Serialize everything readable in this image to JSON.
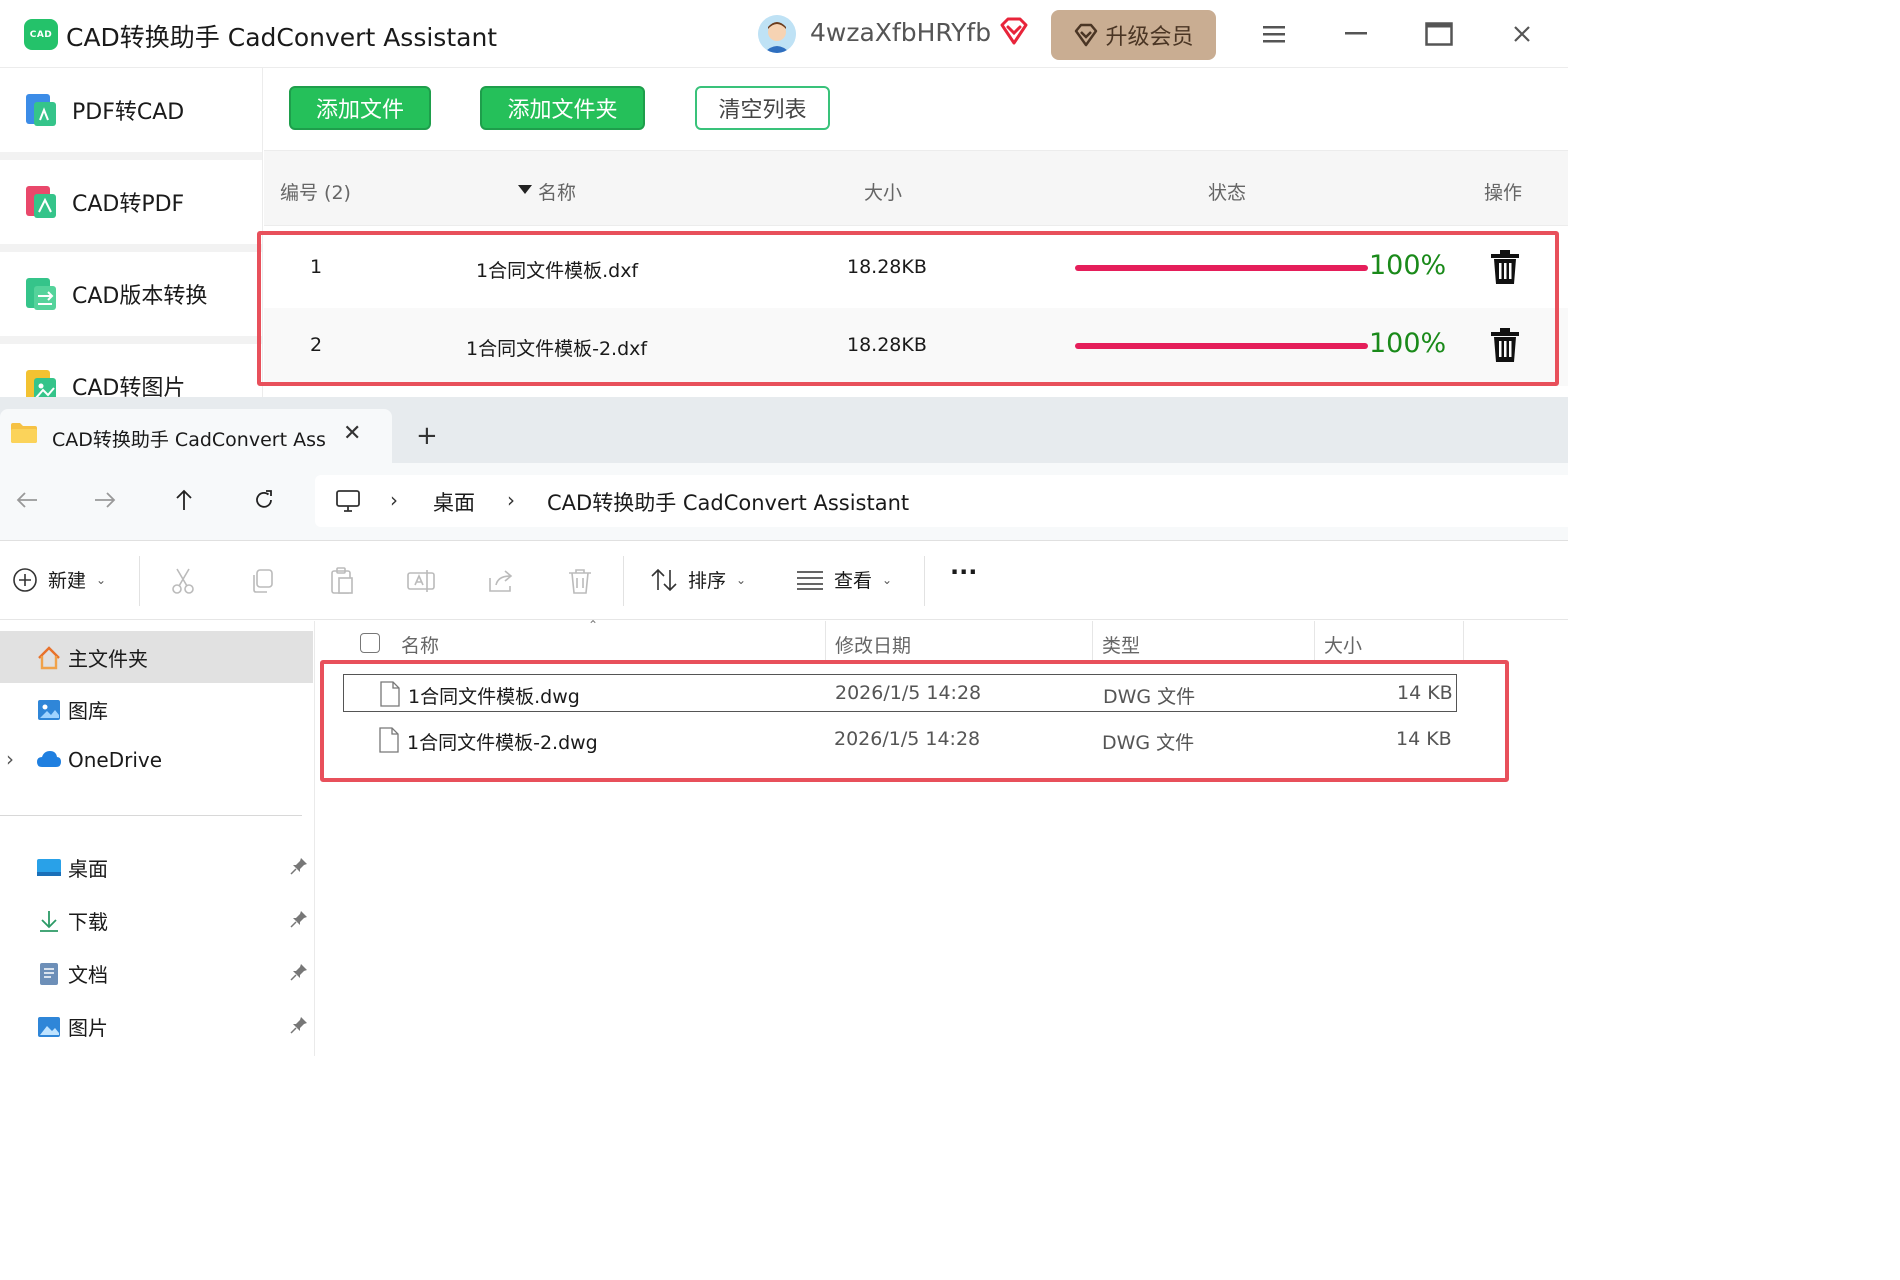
{
  "app": {
    "logo_text": "CAD",
    "title": "CAD转换助手 CadConvert Assistant",
    "username": "4wzaXfbHRYfb",
    "upgrade_label": "升级会员",
    "accent": "#25c05a",
    "sidebar": [
      {
        "label": "PDF转CAD",
        "icon": "pdf-to-cad-icon"
      },
      {
        "label": "CAD转PDF",
        "icon": "cad-to-pdf-icon"
      },
      {
        "label": "CAD版本转换",
        "icon": "cad-version-icon"
      },
      {
        "label": "CAD转图片",
        "icon": "cad-to-image-icon"
      }
    ],
    "toolbar": {
      "add_file": "添加文件",
      "add_folder": "添加文件夹",
      "clear_list": "清空列表"
    },
    "table": {
      "headers": {
        "number": "编号 (2)",
        "name": "名称",
        "size": "大小",
        "status": "状态",
        "action": "操作"
      },
      "rows": [
        {
          "number": "1",
          "name": "1合同文件模板.dxf",
          "size": "18.28KB",
          "progress": 100,
          "percent": "100%"
        },
        {
          "number": "2",
          "name": "1合同文件模板-2.dxf",
          "size": "18.28KB",
          "progress": 100,
          "percent": "100%"
        }
      ]
    }
  },
  "explorer": {
    "tab_title": "CAD转换助手 CadConvert Assi",
    "breadcrumb": [
      "桌面",
      "CAD转换助手 CadConvert Assistant"
    ],
    "commands": {
      "new": "新建",
      "sort": "排序",
      "view": "查看",
      "more": "···"
    },
    "nav": {
      "home": "主文件夹",
      "gallery": "图库",
      "onedrive": "OneDrive",
      "pinned": [
        "桌面",
        "下载",
        "文档",
        "图片"
      ]
    },
    "columns": {
      "name": "名称",
      "modified": "修改日期",
      "type": "类型",
      "size": "大小"
    },
    "files": [
      {
        "name": "1合同文件模板.dwg",
        "modified": "2026/1/5 14:28",
        "type": "DWG 文件",
        "size": "14 KB"
      },
      {
        "name": "1合同文件模板-2.dwg",
        "modified": "2026/1/5 14:28",
        "type": "DWG 文件",
        "size": "14 KB"
      }
    ]
  }
}
